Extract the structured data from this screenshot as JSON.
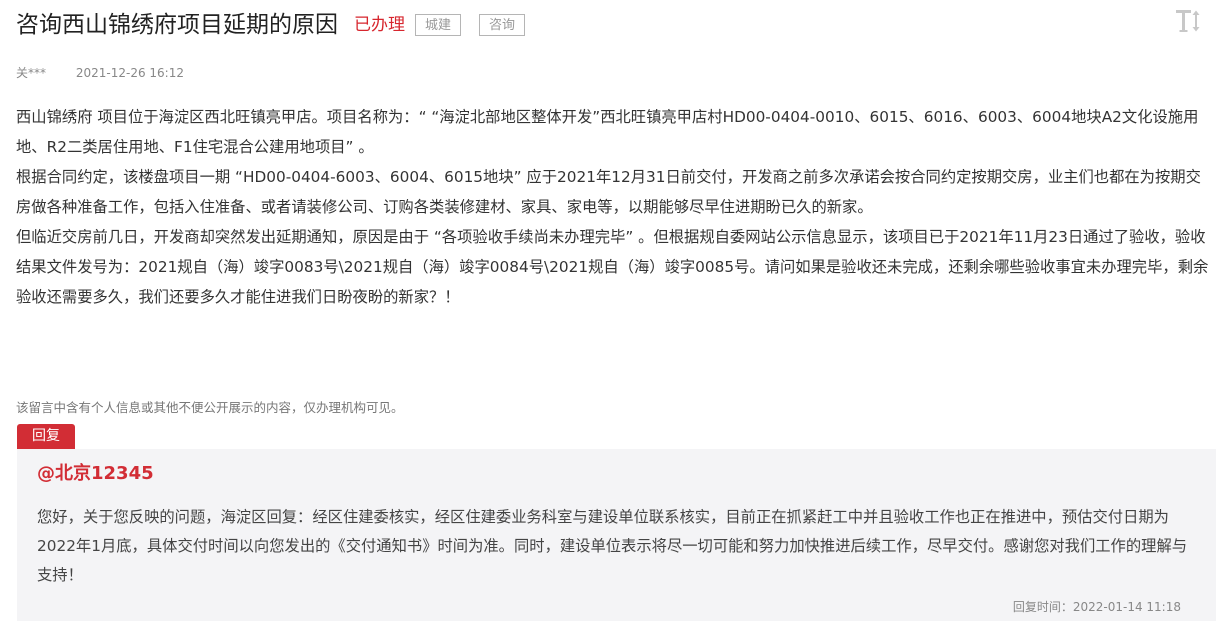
{
  "header": {
    "title": "咨询西山锦绣府项目延期的原因",
    "status": "已办理",
    "tags": [
      "城建",
      "咨询"
    ]
  },
  "meta": {
    "author": "关***",
    "time": "2021-12-26 16:12"
  },
  "content": {
    "paragraphs": [
      "西山锦绣府 项目位于海淀区西北旺镇亮甲店。项目名称为：“ “海淀北部地区整体开发”西北旺镇亮甲店村HD00-0404-0010、6015、6016、6003、6004地块A2文化设施用地、R2二类居住用地、F1住宅混合公建用地项目” 。",
      "根据合同约定，该楼盘项目一期 “HD00-0404-6003、6004、6015地块” 应于2021年12月31日前交付，开发商之前多次承诺会按合同约定按期交房，业主们也都在为按期交房做各种准备工作，包括入住准备、或者请装修公司、订购各类装修建材、家具、家电等，以期能够尽早住进期盼已久的新家。",
      "但临近交房前几日，开发商却突然发出延期通知，原因是由于 “各项验收手续尚未办理完毕” 。但根据规自委网站公示信息显示，该项目已于2021年11月23日通过了验收，验收结果文件发号为：2021规自（海）竣字0083号\\2021规自（海）竣字0084号\\2021规自（海）竣字0085号。请问如果是验收还未完成，还剩余哪些验收事宜未办理完毕，剩余验收还需要多久，我们还要多久才能住进我们日盼夜盼的新家？！"
    ]
  },
  "privacy_note": "该留言中含有个人信息或其他不便公开展示的内容，仅办理机构可见。",
  "reply": {
    "tab_label": "回复",
    "author": "@北京12345",
    "text": "您好，关于您反映的问题，海淀区回复：经区住建委核实，经区住建委业务科室与建设单位联系核实，目前正在抓紧赶工中并且验收工作也正在推进中，预估交付日期为2022年1月底，具体交付时间以向您发出的《交付通知书》时间为准。同时，建设单位表示将尽一切可能和努力加快推进后续工作，尽早交付。感谢您对我们工作的理解与支持！",
    "time": "回复时间：2022-01-14 11:18"
  },
  "icons": {
    "font_size": "text-size-icon"
  },
  "colors": {
    "accent": "#d22d35",
    "status": "#d7262e",
    "reply_bg": "#f4f4f6"
  }
}
